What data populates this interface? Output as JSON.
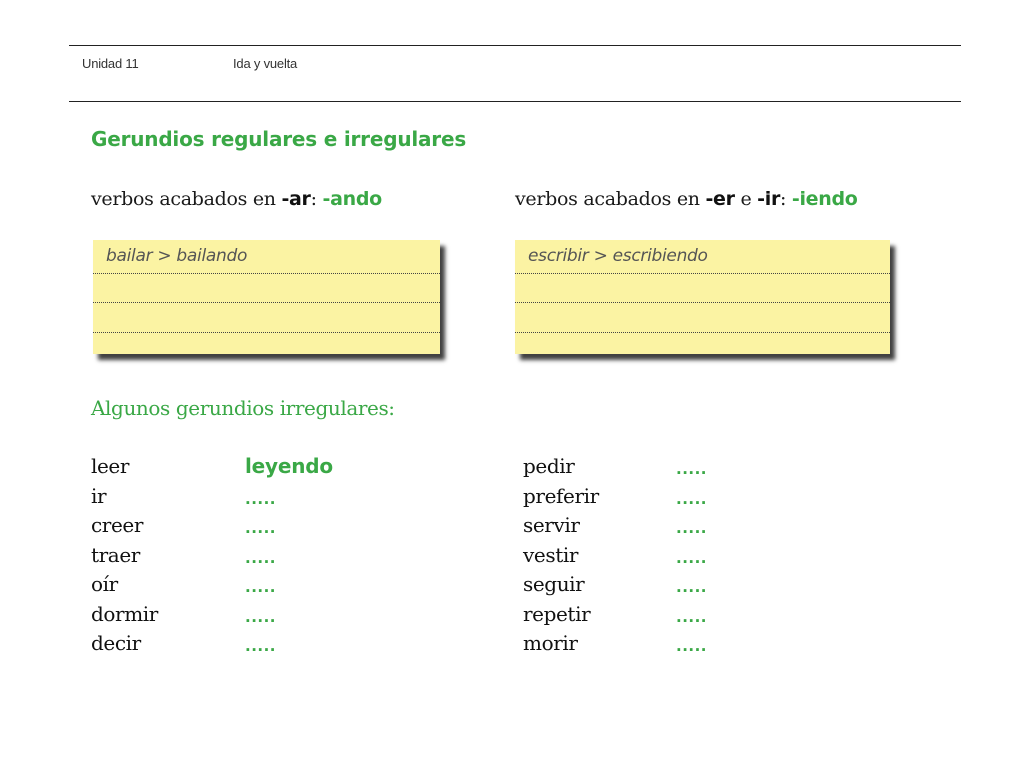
{
  "header": {
    "unit": "Unidad 11",
    "title": "Ida y vuelta"
  },
  "section_title": "Gerundios regulares e irregulares",
  "rules": {
    "left": {
      "prefix": "verbos acabados en ",
      "ending1": "-ar",
      "connector": "",
      "ending2": "",
      "suffix": ": ",
      "gerund_ending": "-ando"
    },
    "right": {
      "prefix": "verbos acabados en ",
      "ending1": "-er",
      "connector": " e ",
      "ending2": "-ir",
      "suffix": ": ",
      "gerund_ending": "-iendo"
    }
  },
  "notes": {
    "left_example": "bailar > bailando",
    "right_example": "escribir > escribiendo"
  },
  "irregular_title": "Algunos gerundios irregulares:",
  "irregular_left": [
    {
      "verb": "leer",
      "gerund": "leyendo"
    },
    {
      "verb": "ir",
      "gerund": "....."
    },
    {
      "verb": "creer",
      "gerund": "....."
    },
    {
      "verb": "traer",
      "gerund": "....."
    },
    {
      "verb": "oír",
      "gerund": "....."
    },
    {
      "verb": "dormir",
      "gerund": "....."
    },
    {
      "verb": "decir",
      "gerund": "....."
    }
  ],
  "irregular_right": [
    {
      "verb": "pedir",
      "gerund": "....."
    },
    {
      "verb": "preferir",
      "gerund": "....."
    },
    {
      "verb": "servir",
      "gerund": "....."
    },
    {
      "verb": "vestir",
      "gerund": "....."
    },
    {
      "verb": "seguir",
      "gerund": "....."
    },
    {
      "verb": "repetir",
      "gerund": "....."
    },
    {
      "verb": "morir",
      "gerund": "....."
    }
  ],
  "colors": {
    "accent_green": "#3aa846",
    "note_yellow": "#fbf3a3"
  }
}
